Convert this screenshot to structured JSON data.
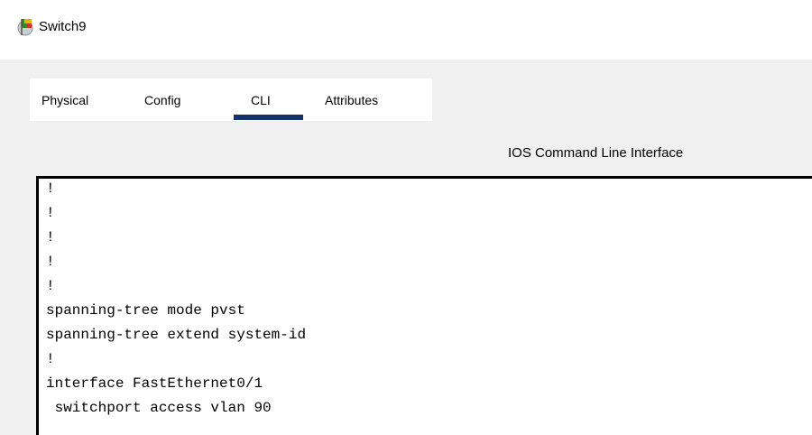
{
  "window": {
    "title": "Switch9"
  },
  "tabs": [
    {
      "label": "Physical"
    },
    {
      "label": "Config"
    },
    {
      "label": "CLI"
    },
    {
      "label": "Attributes"
    }
  ],
  "active_tab": "CLI",
  "panel": {
    "header": "IOS Command Line Interface"
  },
  "terminal": {
    "lines": [
      "!",
      "!",
      "!",
      "!",
      "!",
      "spanning-tree mode pvst",
      "spanning-tree extend system-id",
      "!",
      "interface FastEthernet0/1",
      " switchport access vlan 90"
    ]
  },
  "colors": {
    "tab_underline": "#14336a",
    "window_bg": "#f0f0f0",
    "terminal_bg": "#ffffff"
  }
}
